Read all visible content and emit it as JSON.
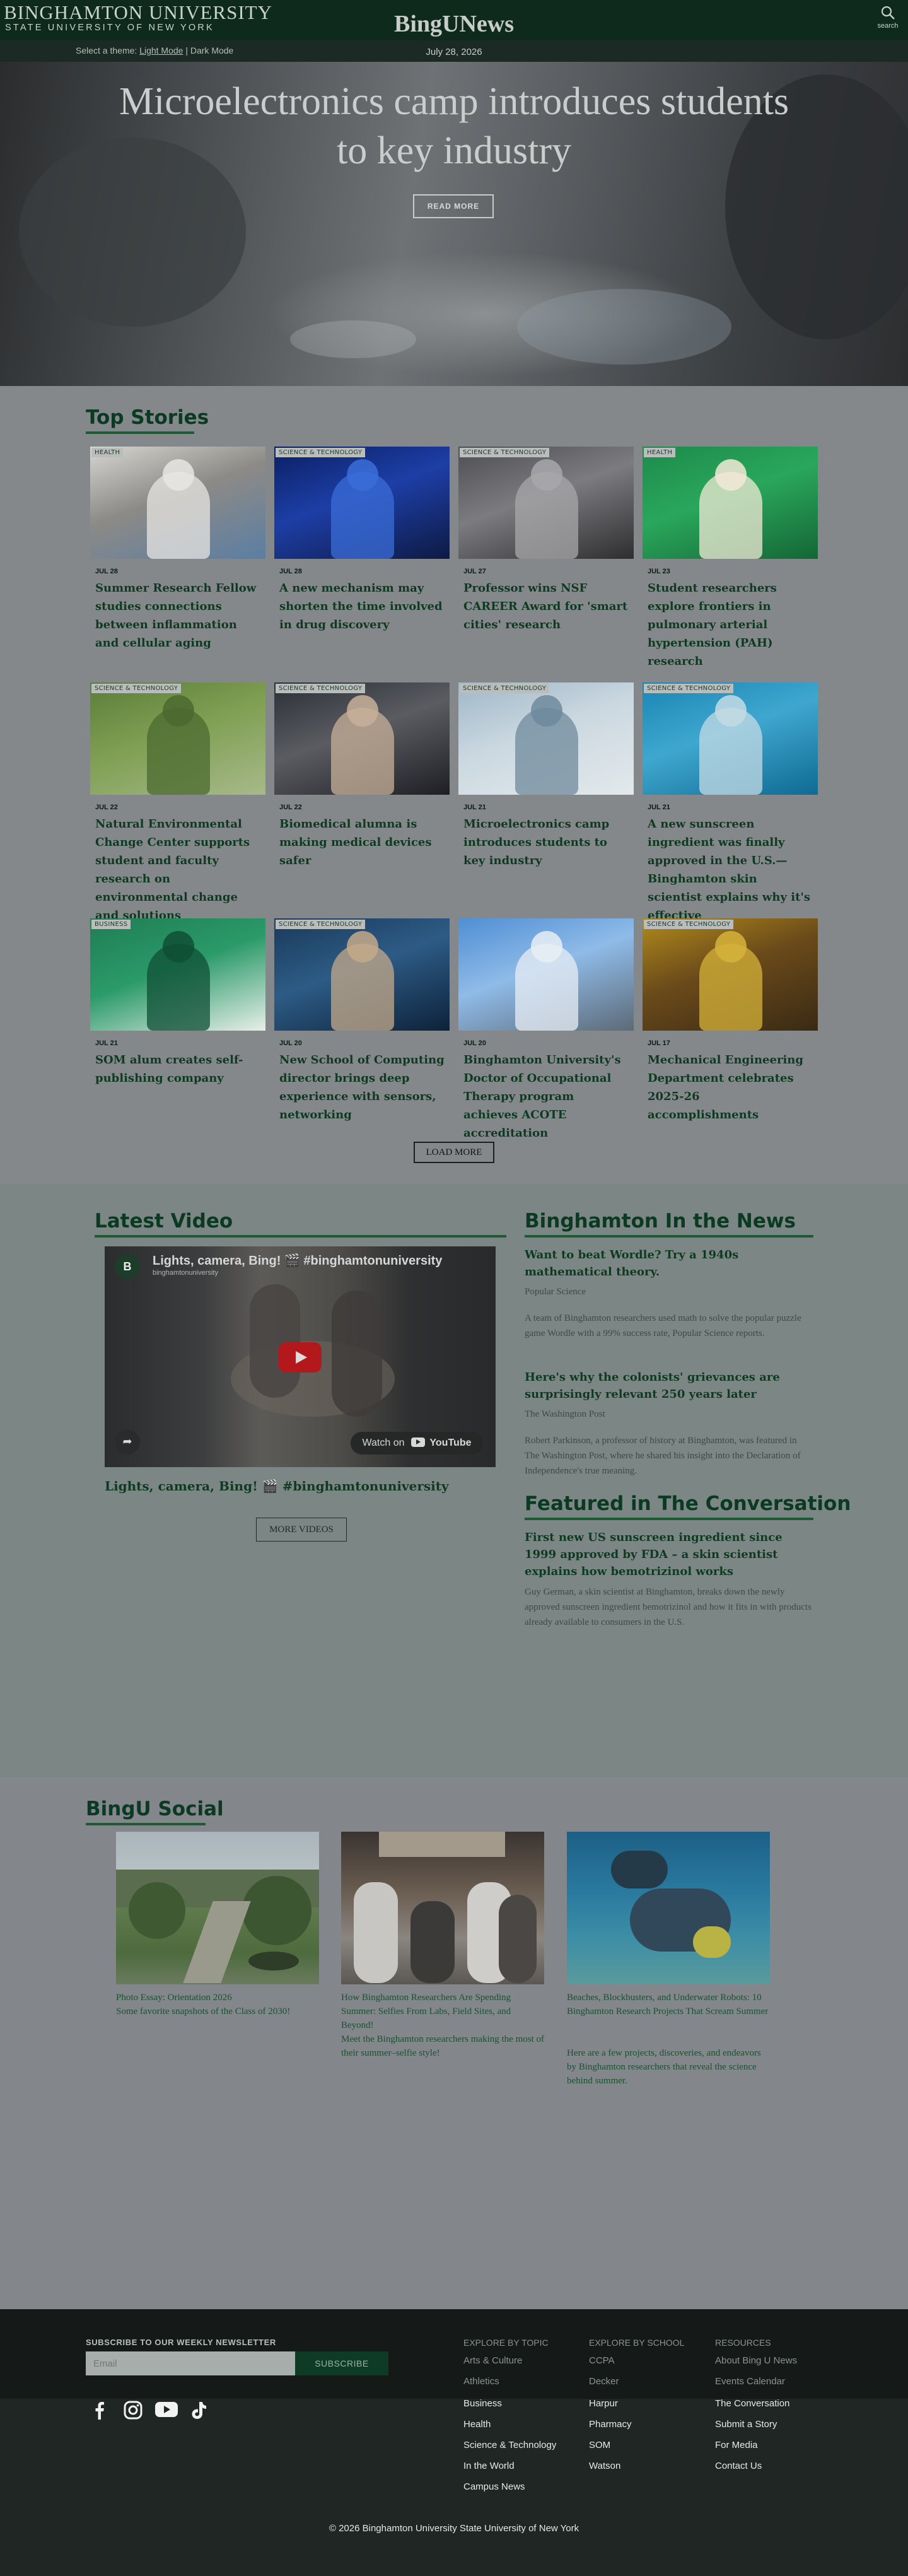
{
  "header": {
    "logo_line1": "BINGHAMTON UNIVERSITY",
    "logo_line2": "STATE UNIVERSITY OF NEW YORK",
    "search_label": "search",
    "theme_prefix": "Select a theme:",
    "theme_light": "Light Mode",
    "theme_sep": "|",
    "theme_dark": "Dark Mode"
  },
  "hero": {
    "brand": "BingUNews",
    "date": "July 28, 2026",
    "title": "Microelectronics camp introduces students to key industry",
    "button": "READ MORE"
  },
  "top_stories": {
    "heading": "Top Stories",
    "cards": [
      {
        "tag": "HEALTH",
        "date": "JUL 28",
        "title": "Summer Research Fellow studies connections between inflammation and cellular aging"
      },
      {
        "tag": "SCIENCE & TECHNOLOGY",
        "date": "JUL 28",
        "title": "A new mechanism may shorten the time involved in drug discovery"
      },
      {
        "tag": "SCIENCE & TECHNOLOGY",
        "date": "JUL 27",
        "title": "Professor wins NSF CAREER Award for 'smart cities' research"
      },
      {
        "tag": "HEALTH",
        "date": "JUL 23",
        "title": "Student researchers explore frontiers in pulmonary arterial hypertension (PAH) research"
      },
      {
        "tag": "SCIENCE & TECHNOLOGY",
        "date": "JUL 22",
        "title": "Natural Environmental Change Center supports student and faculty research on environmental change and solutions"
      },
      {
        "tag": "SCIENCE & TECHNOLOGY",
        "date": "JUL 22",
        "title": "Biomedical alumna is making medical devices safer"
      },
      {
        "tag": "SCIENCE & TECHNOLOGY",
        "date": "JUL 21",
        "title": "Microelectronics camp introduces students to key industry"
      },
      {
        "tag": "SCIENCE & TECHNOLOGY",
        "date": "JUL 21",
        "title": "A new sunscreen ingredient was finally approved in the U.S.—Binghamton skin scientist explains why it's effective"
      },
      {
        "tag": "BUSINESS",
        "date": "JUL 21",
        "title": "SOM alum creates self-publishing company"
      },
      {
        "tag": "SCIENCE & TECHNOLOGY",
        "date": "JUL 20",
        "title": "New School of Computing director brings deep experience with sensors, networking"
      },
      {
        "tag": "",
        "date": "JUL 20",
        "title": "Binghamton University's Doctor of Occupational Therapy program achieves ACOTE accreditation"
      },
      {
        "tag": "SCIENCE & TECHNOLOGY",
        "date": "JUL 17",
        "title": "Mechanical Engineering Department celebrates 2025-26 accomplishments"
      }
    ],
    "load_more": "LOAD MORE"
  },
  "video": {
    "heading": "Latest Video",
    "player_title": "Lights, camera, Bing! 🎬 #binghamtonuniversity",
    "player_channel": "binghamtonuniversity",
    "watch_on": "Watch on",
    "youtube": "YouTube",
    "caption": "Lights, camera, Bing! 🎬 #binghamtonuniversity",
    "more_button": "MORE VIDEOS"
  },
  "in_the_news": {
    "heading": "Binghamton In the News",
    "items": [
      {
        "title": "Want to beat Wordle? Try a 1940s mathematical theory.",
        "source": "Popular Science",
        "desc": "A team of Binghamton researchers used math to solve the popular puzzle game Wordle with a 99% success rate, Popular Science reports."
      },
      {
        "title": "Here's why the colonists' grievances are surprisingly relevant 250 years later",
        "source": "The Washington Post",
        "desc": "Robert Parkinson, a professor of history at Binghamton, was featured in The Washington Post, where he shared his insight into the Declaration of Independence's true meaning."
      }
    ]
  },
  "conversation": {
    "heading": "Featured in The Conversation",
    "title": "First new US sunscreen ingredient since 1999 approved by FDA – a skin scientist explains how bemotrizinol works",
    "desc": "Guy German, a skin scientist at Binghamton, breaks down the newly approved sunscreen ingredient bemotrizinol and how it fits in with products already available to consumers in the U.S."
  },
  "social": {
    "heading": "BingU Social",
    "cards": [
      {
        "title": "Photo Essay: Orientation 2026",
        "desc": "Some favorite snapshots of the Class of 2030!"
      },
      {
        "title": "How Binghamton Researchers Are Spending Summer: Selfies From Labs, Field Sites, and Beyond!",
        "desc": "Meet the Binghamton researchers making the most of their summer–selfie style!"
      },
      {
        "title": "Beaches, Blockbusters, and Underwater Robots: 10 Binghamton Research Projects That Scream Summer",
        "desc": "Here are a few projects, discoveries, and endeavors by Binghamton researchers that reveal the science behind summer."
      }
    ]
  },
  "footer": {
    "newsletter_label": "SUBSCRIBE TO OUR WEEKLY NEWSLETTER",
    "email_placeholder": "Email",
    "subscribe": "SUBSCRIBE",
    "topic_heading": "EXPLORE BY TOPIC",
    "topics": [
      "Arts & Culture",
      "Athletics",
      "Business",
      "Health",
      "Science & Technology",
      "In the World",
      "Campus News"
    ],
    "school_heading": "EXPLORE BY SCHOOL",
    "schools": [
      "CCPA",
      "Decker",
      "Harpur",
      "Pharmacy",
      "SOM",
      "Watson"
    ],
    "resources_heading": "RESOURCES",
    "resources": [
      "About Bing U News",
      "Events Calendar",
      "The Conversation",
      "Submit a Story",
      "For Media",
      "Contact Us"
    ],
    "social_icons": [
      "facebook-icon",
      "instagram-icon",
      "youtube-icon",
      "tiktok-icon"
    ],
    "copyright": "© 2026 Binghamton University State University of New York"
  }
}
